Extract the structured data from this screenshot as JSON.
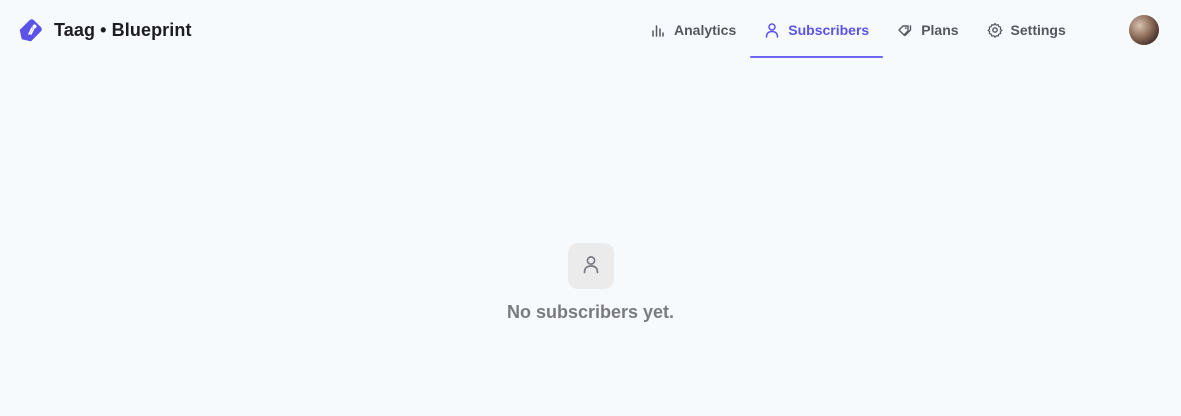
{
  "brand": {
    "name": "Taag • Blueprint",
    "logo_icon": "tag-icon",
    "logo_color": "#5b52e8"
  },
  "nav": {
    "items": [
      {
        "label": "Analytics",
        "icon": "bar-chart-icon",
        "active": false
      },
      {
        "label": "Subscribers",
        "icon": "user-icon",
        "active": true
      },
      {
        "label": "Plans",
        "icon": "tags-icon",
        "active": false
      },
      {
        "label": "Settings",
        "icon": "gear-icon",
        "active": false
      }
    ],
    "active_color": "#5b52e8"
  },
  "user": {
    "avatar_icon": "avatar"
  },
  "empty_state": {
    "icon": "user-icon",
    "message": "No subscribers yet."
  }
}
